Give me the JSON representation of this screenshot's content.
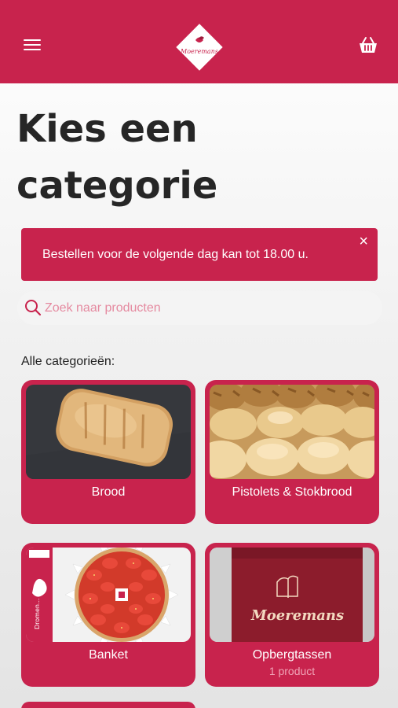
{
  "colors": {
    "brand": "#c8234d",
    "background": "#f1f1f1"
  },
  "header": {
    "menu_icon": "hamburger-icon",
    "logo_text": "Moeremans",
    "basket_icon": "basket-icon"
  },
  "page": {
    "title_line1": "Kies een",
    "title_line2": "categorie"
  },
  "banner": {
    "text": "Bestellen voor de volgende dag kan tot 18.00 u.",
    "close": "×"
  },
  "search": {
    "placeholder": "Zoek naar producten",
    "icon": "search-icon"
  },
  "categories_label": "Alle categorieën:",
  "categories": [
    {
      "title": "Brood",
      "count": ""
    },
    {
      "title": "Pistolets & Stokbrood",
      "count": ""
    },
    {
      "title": "Banket",
      "count": ""
    },
    {
      "title": "Opbergtassen",
      "count": "1 product"
    }
  ],
  "images": {
    "bag_text": "Moeremans",
    "box_label": "Dromen..."
  }
}
